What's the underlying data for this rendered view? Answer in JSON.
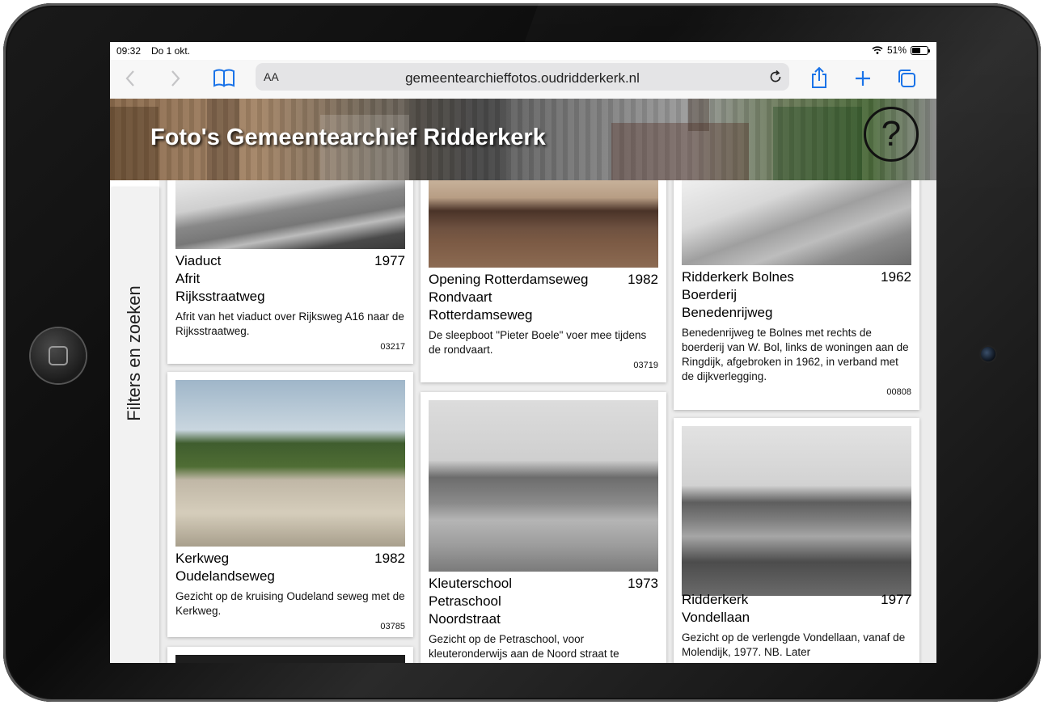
{
  "status": {
    "time": "09:32",
    "date": "Do 1 okt.",
    "battery": "51%"
  },
  "browser": {
    "text_size": "AA",
    "url": "gemeentearchieffotos.oudridderkerk.nl"
  },
  "site": {
    "title": "Foto's Gemeentearchief Ridderkerk",
    "help": "?"
  },
  "sidebar": {
    "label": "Filters en zoeken"
  },
  "cards": [
    {
      "lines": [
        "Viaduct",
        "Afrit",
        "Rijksstraatweg"
      ],
      "year": "1977",
      "desc": "Afrit van het viaduct over Rijksweg A16 naar de Rijksstraatweg.",
      "id": "03217"
    },
    {
      "lines": [
        "Opening Rotterdamseweg",
        "Rondvaart",
        "Rotterdamseweg"
      ],
      "year": "1982",
      "desc": "De sleepboot \"Pieter Boele\" voer mee tijdens de rondvaart.",
      "id": "03719"
    },
    {
      "lines": [
        "Ridderkerk Bolnes",
        "Boerderij",
        "Benedenrijweg"
      ],
      "year": "1962",
      "desc": "Benedenrijweg te Bolnes met rechts de boerderij van W. Bol, links de woningen aan de Ringdijk, afgebroken in 1962, in verband met de dijkverlegging.",
      "id": "00808"
    },
    {
      "lines": [
        "Kerkweg",
        "Oudelandseweg"
      ],
      "year": "1982",
      "desc": "Gezicht op de kruising Oudeland seweg met de Kerkweg.",
      "id": "03785"
    },
    {
      "lines": [
        "Kleuterschool",
        "Petraschool",
        "Noordstraat"
      ],
      "year": "1973",
      "desc": "Gezicht op de Petraschool, voor kleuteronderwijs aan de Noord straat te",
      "id": ""
    },
    {
      "lines": [
        "Ridderkerk",
        "Vondellaan"
      ],
      "year": "1977",
      "desc": "Gezicht op de verlengde Vondellaan, vanaf de Molendijk, 1977. NB. Later",
      "id": ""
    }
  ]
}
